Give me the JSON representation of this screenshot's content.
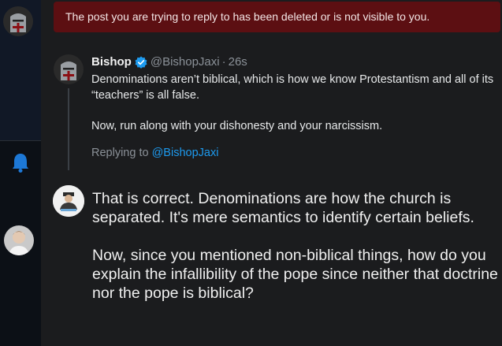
{
  "notice": {
    "text": "The post you are trying to reply to has been deleted or is not visible to you."
  },
  "post": {
    "author_name": "Bishop",
    "author_handle": "@BishopJaxi",
    "separator": "·",
    "time": "26s",
    "paragraphs": [
      "Denominations aren’t biblical, which is how we know Protestantism and all of its “teachers” is all false.",
      "Now, run along with your dishonesty and your narcissism."
    ],
    "replying_prefix": "Replying to",
    "replying_to": "@BishopJaxi"
  },
  "reply": {
    "paragraphs": [
      "That is correct. Denominations are how the church is separated. It's mere semantics to identify certain beliefs.",
      "Now, since you mentioned non-biblical things, how do you explain the infallibility of the pope since neither that doctrine nor the pope is biblical?"
    ]
  },
  "colors": {
    "notice_bg": "#5c0f12",
    "accent": "#1d9bf0",
    "background": "#1b1c1e",
    "sidebar": "#0c1016"
  },
  "icons": {
    "sidebar_avatar": "crusader-helmet-avatar",
    "notifications": "bell-icon",
    "sidebar_user": "user-photo-avatar",
    "verified": "verified-badge-icon",
    "reply_avatar": "reply-author-avatar"
  }
}
